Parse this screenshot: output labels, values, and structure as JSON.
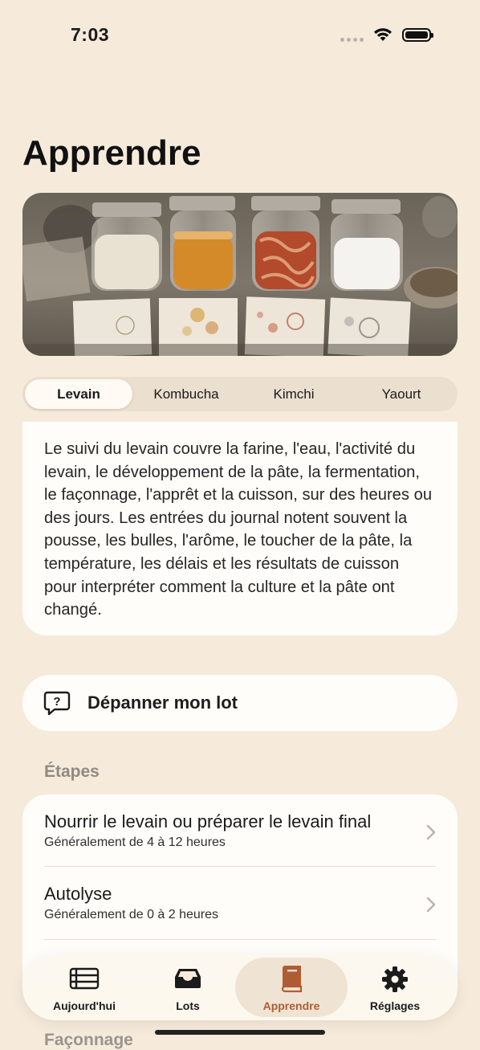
{
  "status_bar": {
    "time": "7:03"
  },
  "page": {
    "title": "Apprendre"
  },
  "segments": [
    {
      "label": "Levain",
      "selected": true
    },
    {
      "label": "Kombucha",
      "selected": false
    },
    {
      "label": "Kimchi",
      "selected": false
    },
    {
      "label": "Yaourt",
      "selected": false
    }
  ],
  "description": "Le suivi du levain couvre la farine, l'eau, l'activité du levain, le développement de la pâte, la fermentation, le façonnage, l'apprêt et la cuisson, sur des heures ou des jours. Les entrées du journal notent souvent la pousse, les bulles, l'arôme, le toucher de la pâte, la température, les délais et les résultats de cuisson pour interpréter comment la culture et la pâte ont changé.",
  "troubleshoot": {
    "label": "Dépanner mon lot"
  },
  "steps_section": {
    "header": "Étapes",
    "items": [
      {
        "title": "Nourrir le levain ou préparer le levain final",
        "subtitle": "Généralement de 4 à 12 heures"
      },
      {
        "title": "Autolyse",
        "subtitle": "Généralement de 0 à 2 heures"
      }
    ],
    "next_header": "Façonnage"
  },
  "tabbar": {
    "accent": "#b05c33",
    "items": [
      {
        "label": "Aujourd'hui",
        "icon": "today-icon"
      },
      {
        "label": "Lots",
        "icon": "tray-icon"
      },
      {
        "label": "Apprendre",
        "icon": "book-icon",
        "active": true
      },
      {
        "label": "Réglages",
        "icon": "gear-icon"
      }
    ]
  }
}
